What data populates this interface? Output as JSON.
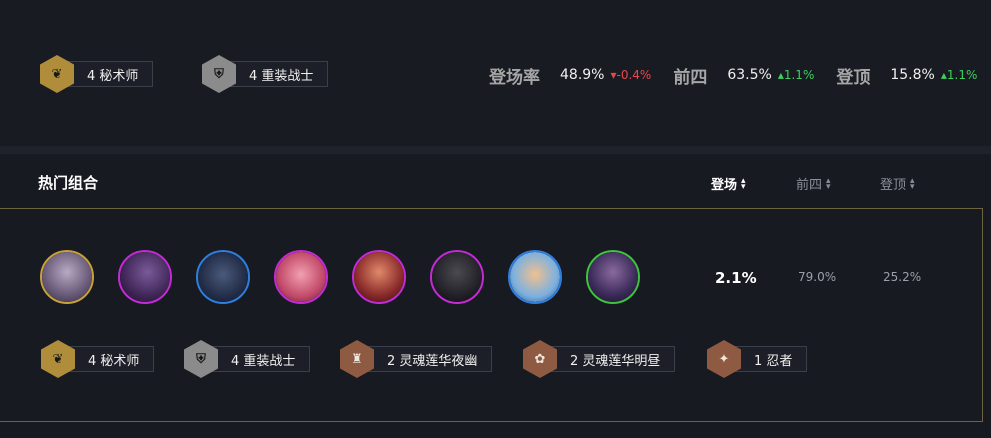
{
  "summary": {
    "traits": [
      {
        "label": "4 秘术师",
        "icon": "arcanist-icon",
        "tier": "gold"
      },
      {
        "label": "4 重装战士",
        "icon": "vanguard-helmet-icon",
        "tier": "silver"
      }
    ],
    "stats": [
      {
        "label": "登场率",
        "value": "48.9%",
        "delta": "-0.4%",
        "direction": "down"
      },
      {
        "label": "前四",
        "value": "63.5%",
        "delta": "1.1%",
        "direction": "up"
      },
      {
        "label": "登顶",
        "value": "15.8%",
        "delta": "1.1%",
        "direction": "up"
      }
    ]
  },
  "section": {
    "title": "热门组合",
    "columns": [
      {
        "label": "登场",
        "active": true
      },
      {
        "label": "前四",
        "active": false
      },
      {
        "label": "登顶",
        "active": false
      }
    ]
  },
  "combos": [
    {
      "champions": [
        {
          "icon": "champion-portrait-icon",
          "rarity": "gold"
        },
        {
          "icon": "champion-portrait-icon",
          "rarity": "purple"
        },
        {
          "icon": "champion-portrait-icon",
          "rarity": "blue"
        },
        {
          "icon": "champion-portrait-icon",
          "rarity": "purple"
        },
        {
          "icon": "champion-portrait-icon",
          "rarity": "purple"
        },
        {
          "icon": "champion-portrait-icon",
          "rarity": "purple"
        },
        {
          "icon": "champion-portrait-icon",
          "rarity": "blue"
        },
        {
          "icon": "champion-portrait-icon",
          "rarity": "green"
        }
      ],
      "play_rate": "2.1%",
      "top4": "79.0%",
      "win": "25.2%",
      "traits": [
        {
          "label": "4 秘术师",
          "icon": "arcanist-icon",
          "tier": "gold"
        },
        {
          "label": "4 重装战士",
          "icon": "vanguard-helmet-icon",
          "tier": "silver"
        },
        {
          "label": "2 灵魂莲华夜幽",
          "icon": "lantern-icon",
          "tier": "bronze"
        },
        {
          "label": "2 灵魂莲华明昼",
          "icon": "lotus-icon",
          "tier": "bronze"
        },
        {
          "label": "1 忍者",
          "icon": "shuriken-icon",
          "tier": "bronze"
        }
      ]
    }
  ],
  "colors": {
    "gold": "#b08d3a",
    "silver": "#8b8b8b",
    "bronze": "#8e5a42",
    "up": "#3ecf5e",
    "down": "#e5484d"
  }
}
